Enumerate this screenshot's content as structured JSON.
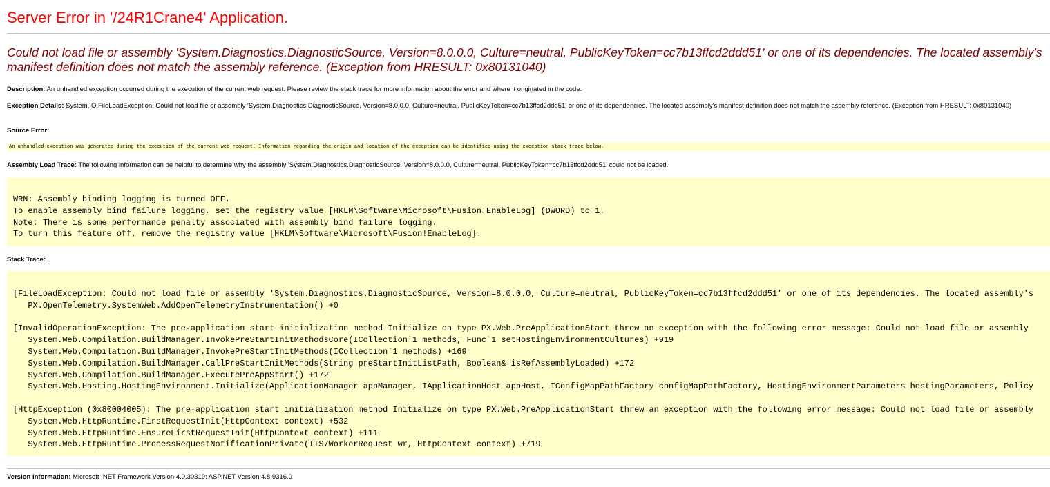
{
  "page": {
    "title": "Server Error in '/24R1Crane4' Application.",
    "error_message": "Could not load file or assembly 'System.Diagnostics.DiagnosticSource, Version=8.0.0.0, Culture=neutral, PublicKeyToken=cc7b13ffcd2ddd51' or one of its dependencies. The located assembly's manifest definition does not match the assembly reference. (Exception from HRESULT: 0x80131040)"
  },
  "description": {
    "label": "Description:",
    "text": "An unhandled exception occurred during the execution of the current web request. Please review the stack trace for more information about the error and where it originated in the code."
  },
  "exception_details": {
    "label": "Exception Details:",
    "text": "System.IO.FileLoadException: Could not load file or assembly 'System.Diagnostics.DiagnosticSource, Version=8.0.0.0, Culture=neutral, PublicKeyToken=cc7b13ffcd2ddd51' or one of its dependencies. The located assembly's manifest definition does not match the assembly reference. (Exception from HRESULT: 0x80131040)"
  },
  "source_error": {
    "label": "Source Error:",
    "text": "An unhandled exception was generated during the execution of the current web request. Information regarding the origin and location of the exception can be identified using the exception stack trace below."
  },
  "assembly_load_trace": {
    "label": "Assembly Load Trace:",
    "text": "The following information can be helpful to determine why the assembly 'System.Diagnostics.DiagnosticSource, Version=8.0.0.0, Culture=neutral, PublicKeyToken=cc7b13ffcd2ddd51' could not be loaded.",
    "body": "WRN: Assembly binding logging is turned OFF.\nTo enable assembly bind failure logging, set the registry value [HKLM\\Software\\Microsoft\\Fusion!EnableLog] (DWORD) to 1.\nNote: There is some performance penalty associated with assembly bind failure logging.\nTo turn this feature off, remove the registry value [HKLM\\Software\\Microsoft\\Fusion!EnableLog]."
  },
  "stack_trace": {
    "label": "Stack Trace:",
    "body": "[FileLoadException: Could not load file or assembly 'System.Diagnostics.DiagnosticSource, Version=8.0.0.0, Culture=neutral, PublicKeyToken=cc7b13ffcd2ddd51' or one of its dependencies. The located assembly's\n   PX.OpenTelemetry.SystemWeb.AddOpenTelemetryInstrumentation() +0\n\n[InvalidOperationException: The pre-application start initialization method Initialize on type PX.Web.PreApplicationStart threw an exception with the following error message: Could not load file or assembly\n   System.Web.Compilation.BuildManager.InvokePreStartInitMethodsCore(ICollection`1 methods, Func`1 setHostingEnvironmentCultures) +919\n   System.Web.Compilation.BuildManager.InvokePreStartInitMethods(ICollection`1 methods) +169\n   System.Web.Compilation.BuildManager.CallPreStartInitMethods(String preStartInitListPath, Boolean& isRefAssemblyLoaded) +172\n   System.Web.Compilation.BuildManager.ExecutePreAppStart() +172\n   System.Web.Hosting.HostingEnvironment.Initialize(ApplicationManager appManager, IApplicationHost appHost, IConfigMapPathFactory configMapPathFactory, HostingEnvironmentParameters hostingParameters, Policy\n\n[HttpException (0x80004005): The pre-application start initialization method Initialize on type PX.Web.PreApplicationStart threw an exception with the following error message: Could not load file or assembly\n   System.Web.HttpRuntime.FirstRequestInit(HttpContext context) +532\n   System.Web.HttpRuntime.EnsureFirstRequestInit(HttpContext context) +111\n   System.Web.HttpRuntime.ProcessRequestNotificationPrivate(IIS7WorkerRequest wr, HttpContext context) +719"
  },
  "version_information": {
    "label": "Version Information:",
    "text": "Microsoft .NET Framework Version:4.0.30319; ASP.NET Version:4.8.9316.0"
  },
  "colors": {
    "title": "#ff0000",
    "error_message": "#800000",
    "code_background": "#ffffcc",
    "rule": "#c0c0c0"
  }
}
